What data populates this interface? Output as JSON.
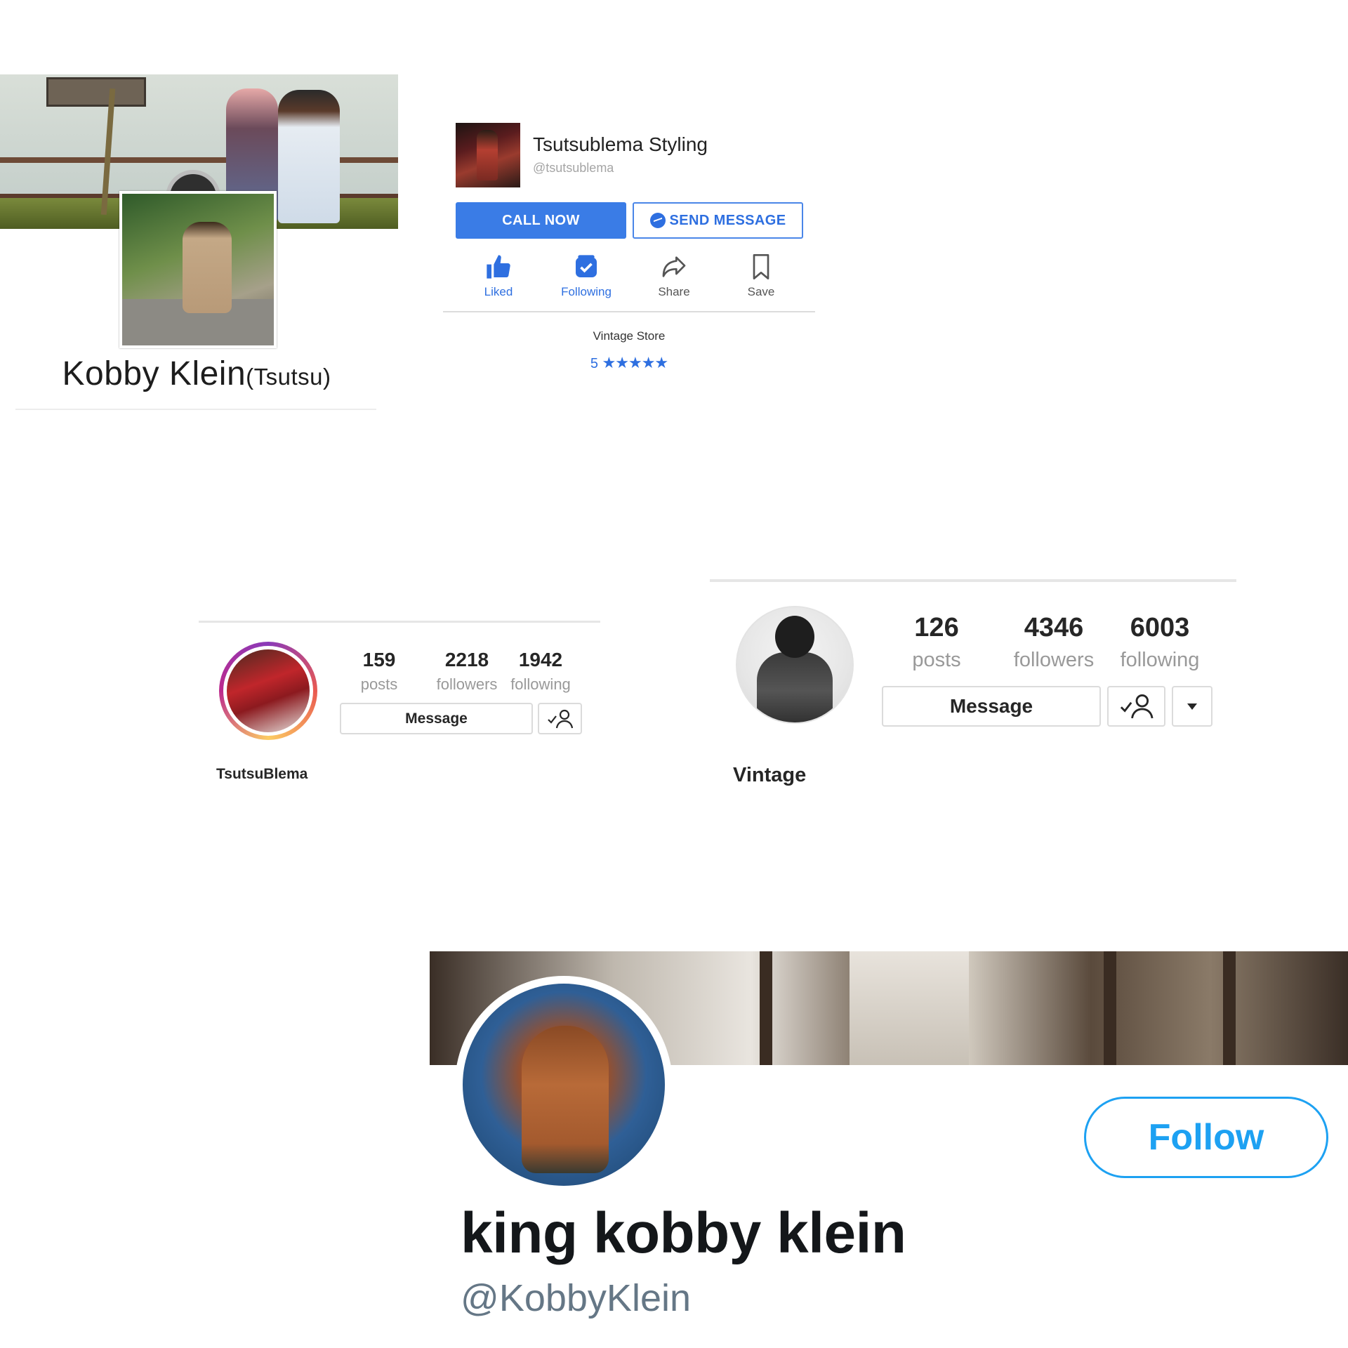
{
  "fb_profile": {
    "name": "Kobby Klein",
    "nickname": "(Tsutsu)"
  },
  "fb_page": {
    "name": "Tsutsublema Styling",
    "handle": "@tsutsublema",
    "call_now_label": "CALL NOW",
    "send_message_label": "SEND MESSAGE",
    "actions": [
      {
        "label": "Liked",
        "icon": "thumbs-up-icon"
      },
      {
        "label": "Following",
        "icon": "following-check-icon"
      },
      {
        "label": "Share",
        "icon": "share-arrow-icon"
      },
      {
        "label": "Save",
        "icon": "bookmark-icon"
      }
    ],
    "category": "Vintage Store",
    "rating_value": "5",
    "rating_stars": "★★★★★",
    "accent": "#3a7ce6"
  },
  "ig_profile_1": {
    "posts": "159",
    "posts_label": "posts",
    "followers": "2218",
    "followers_label": "followers",
    "following": "1942",
    "following_label": "following",
    "message_label": "Message",
    "username": "TsutsuBlema"
  },
  "ig_profile_2": {
    "posts": "126",
    "posts_label": "posts",
    "followers": "4346",
    "followers_label": "followers",
    "following": "6003",
    "following_label": "following",
    "message_label": "Message",
    "username": "Vintage"
  },
  "twitter_profile": {
    "follow_label": "Follow",
    "name": "king kobby klein",
    "handle": "@KobbyKlein",
    "accent": "#1da1f2"
  }
}
